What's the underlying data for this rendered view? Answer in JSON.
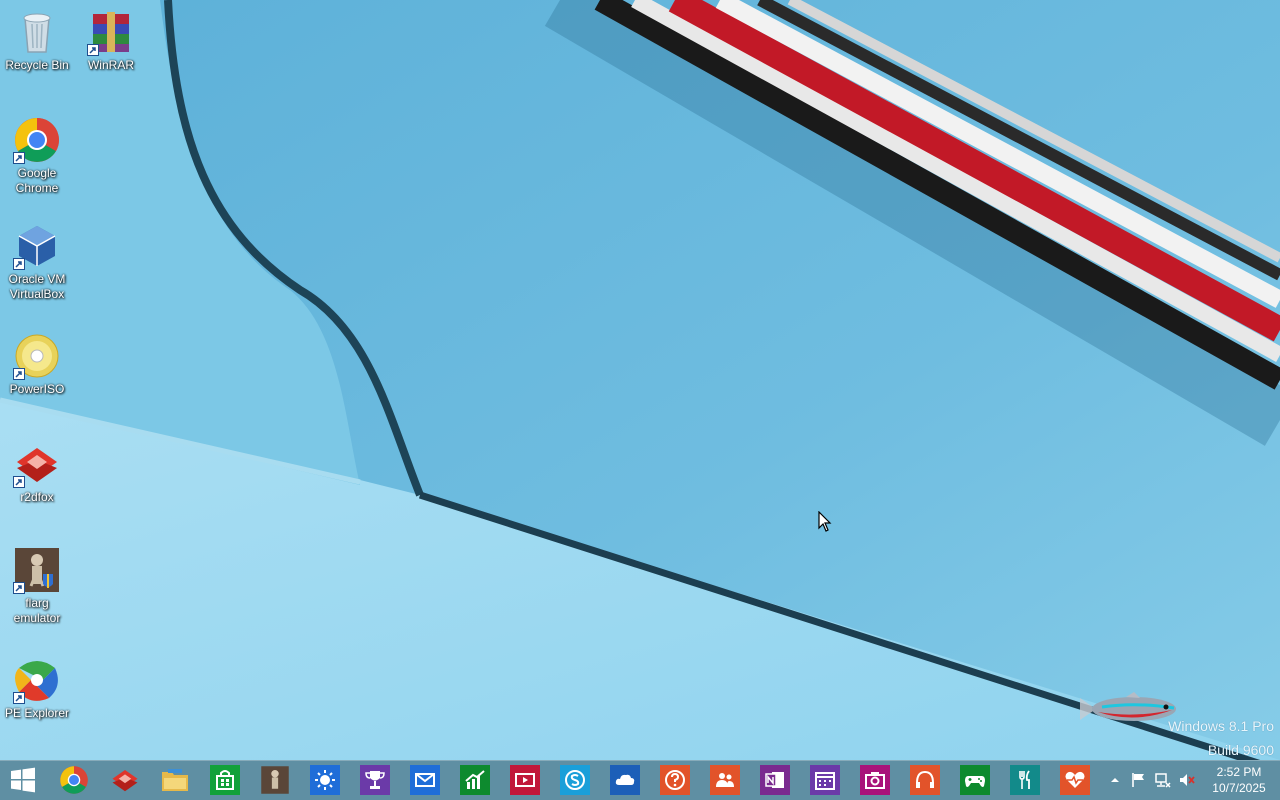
{
  "desktop": {
    "icons": [
      {
        "label": "Recycle Bin",
        "icon": "recycle-bin-icon"
      },
      {
        "label": "WinRAR",
        "icon": "winrar-icon"
      },
      {
        "label": "Google\nChrome",
        "icon": "chrome-icon"
      },
      {
        "label": "Oracle VM\nVirtualBox",
        "icon": "virtualbox-icon"
      },
      {
        "label": "PowerISO",
        "icon": "poweriso-icon"
      },
      {
        "label": "r2dfox",
        "icon": "r2dfox-icon"
      },
      {
        "label": "flarg\nemulator",
        "icon": "flarg-emulator-icon"
      },
      {
        "label": "PE Explorer",
        "icon": "pe-explorer-icon"
      }
    ],
    "watermark": {
      "edition": "Windows 8.1 Pro",
      "build": "Build 9600"
    }
  },
  "taskbar": {
    "start_icon": "windows-logo-icon",
    "pinned": [
      {
        "name": "chrome",
        "icon": "chrome-icon",
        "color": "#5f8fa3"
      },
      {
        "name": "r2dfox",
        "icon": "r2dfox-icon",
        "color": "#5f8fa3"
      },
      {
        "name": "file-explorer",
        "icon": "folder-icon",
        "color": "#5f8fa3"
      },
      {
        "name": "store",
        "icon": "store-bag-icon",
        "color": "#12a13a"
      },
      {
        "name": "flarg-emulator",
        "icon": "flarg-emulator-icon",
        "color": "#5f8fa3"
      },
      {
        "name": "weather",
        "icon": "sun-icon",
        "color": "#1f6dd8"
      },
      {
        "name": "sports",
        "icon": "trophy-icon",
        "color": "#6b3aa8"
      },
      {
        "name": "mail",
        "icon": "mail-icon",
        "color": "#1f6dd8"
      },
      {
        "name": "finance",
        "icon": "chart-icon",
        "color": "#0d8a2e"
      },
      {
        "name": "video",
        "icon": "video-icon",
        "color": "#c1183a"
      },
      {
        "name": "skype",
        "icon": "skype-icon",
        "color": "#1a9fd9"
      },
      {
        "name": "onedrive",
        "icon": "cloud-icon",
        "color": "#1c5fb8"
      },
      {
        "name": "help-tips",
        "icon": "question-icon",
        "color": "#e2532a"
      },
      {
        "name": "people",
        "icon": "people-icon",
        "color": "#e2532a"
      },
      {
        "name": "onenote",
        "icon": "onenote-icon",
        "color": "#7a2a8f"
      },
      {
        "name": "calendar",
        "icon": "calendar-icon",
        "color": "#6b3aa8"
      },
      {
        "name": "camera",
        "icon": "camera-icon",
        "color": "#a8127a"
      },
      {
        "name": "music",
        "icon": "headphones-icon",
        "color": "#e2532a"
      },
      {
        "name": "games",
        "icon": "gamepad-icon",
        "color": "#0d8a2e"
      },
      {
        "name": "food-drink",
        "icon": "fork-knife-icon",
        "color": "#128a8a"
      },
      {
        "name": "health-fitness",
        "icon": "heart-pulse-icon",
        "color": "#e2532a"
      }
    ],
    "tray": {
      "icons": [
        "chevron-up-icon",
        "flag-icon",
        "network-icon",
        "volume-muted-icon"
      ]
    },
    "clock": {
      "time": "2:52 PM",
      "date": "10/7/2025"
    }
  }
}
